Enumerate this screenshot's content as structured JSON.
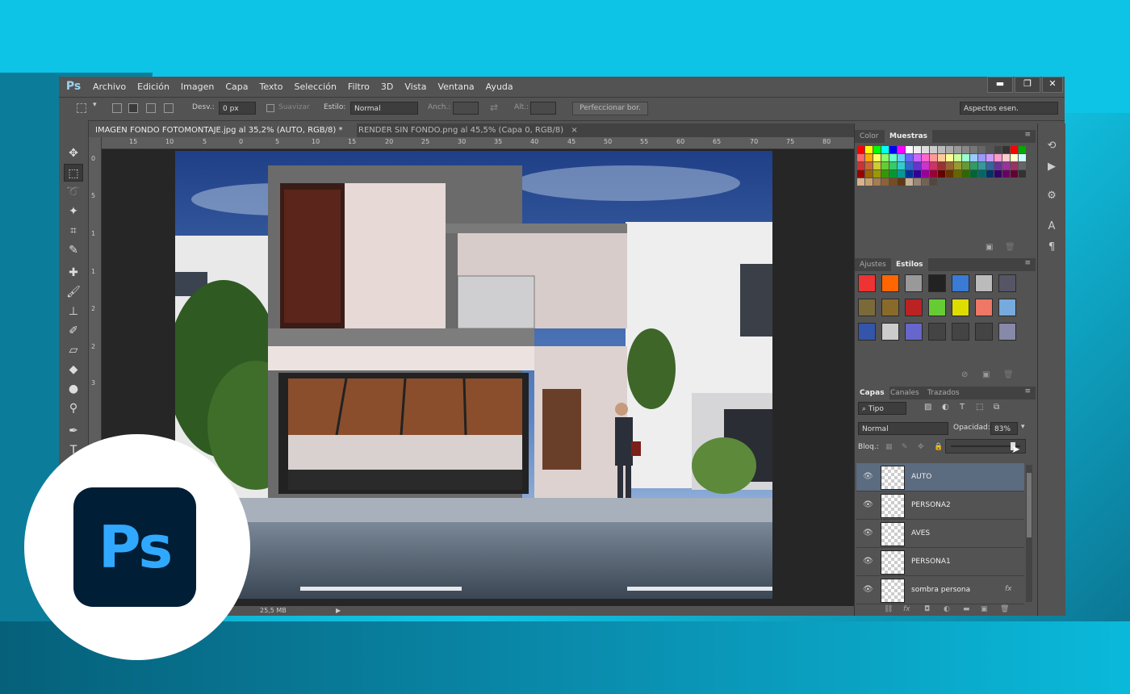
{
  "app": {
    "logo": "Ps"
  },
  "menu": [
    "Archivo",
    "Edición",
    "Imagen",
    "Capa",
    "Texto",
    "Selección",
    "Filtro",
    "3D",
    "Vista",
    "Ventana",
    "Ayuda"
  ],
  "options": {
    "feather_label": "Desv.:",
    "feather_value": "0 px",
    "smooth_label": "Suavizar",
    "style_label": "Estilo:",
    "style_value": "Normal",
    "width_label": "Anch.:",
    "height_label": "Alt.:",
    "refine_label": "Perfeccionar bor.",
    "workspace_value": "Aspectos esen."
  },
  "tabs": [
    {
      "label": "IMAGEN FONDO FOTOMONTAJE.jpg al 35,2% (AUTO, RGB/8) *",
      "close": "×"
    },
    {
      "label": "RENDER SIN FONDO.png al 45,5% (Capa 0, RGB/8)",
      "close": "×"
    }
  ],
  "ruler_h": [
    "15",
    "10",
    "5",
    "0",
    "5",
    "10",
    "15",
    "20",
    "25",
    "30",
    "35",
    "40",
    "45",
    "50",
    "55",
    "60",
    "65",
    "70",
    "75",
    "80"
  ],
  "ruler_v": [
    "0",
    "5",
    "1",
    "1",
    "2",
    "2",
    "3"
  ],
  "status": "25,5 MB",
  "panels": {
    "color_tab": "Color",
    "swatches_tab": "Muestras",
    "adjust_tab": "Ajustes",
    "styles_tab": "Estilos",
    "layers_tab": "Capas",
    "channels_tab": "Canales",
    "paths_tab": "Trazados",
    "kind_label": "Tipo",
    "blend_mode": "Normal",
    "opacity_label": "Opacidad:",
    "opacity_value": "83%",
    "lock_label": "Bloq.:"
  },
  "layers": [
    {
      "name": "AUTO",
      "selected": true,
      "fx": ""
    },
    {
      "name": "PERSONA2",
      "selected": false,
      "fx": ""
    },
    {
      "name": "AVES",
      "selected": false,
      "fx": ""
    },
    {
      "name": "PERSONA1",
      "selected": false,
      "fx": ""
    },
    {
      "name": "sombra persona",
      "selected": false,
      "fx": "fx"
    }
  ],
  "badge": {
    "text": "Ps"
  },
  "colors": {
    "accent": "#31a8ff",
    "badge_bg": "#001e36",
    "ui": "#535353"
  }
}
